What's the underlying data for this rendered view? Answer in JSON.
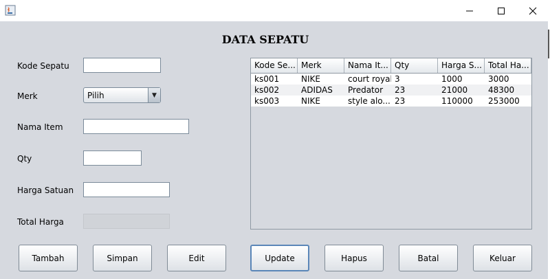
{
  "window": {
    "title": "",
    "minimize_glyph": "—",
    "maximize_glyph": "☐",
    "close_glyph": "✕"
  },
  "form": {
    "title": "DATA SEPATU",
    "fields": {
      "kode_sepatu": {
        "label": "Kode Sepatu",
        "value": ""
      },
      "merk": {
        "label": "Merk",
        "selected": "Pilih"
      },
      "nama_item": {
        "label": "Nama Item",
        "value": ""
      },
      "qty": {
        "label": "Qty",
        "value": ""
      },
      "harga_satuan": {
        "label": "Harga Satuan",
        "value": ""
      },
      "total_harga": {
        "label": "Total Harga",
        "value": ""
      }
    }
  },
  "table": {
    "headers": [
      "Kode Se...",
      "Merk",
      "Nama It...",
      "Qty",
      "Harga S...",
      "Total Ha..."
    ],
    "rows": [
      [
        "ks001",
        "NIKE",
        "court royal",
        "3",
        "1000",
        "3000"
      ],
      [
        "ks002",
        "ADIDAS",
        "Predator",
        "23",
        "21000",
        "48300"
      ],
      [
        "ks003",
        "NIKE",
        "style alo...",
        "23",
        "110000",
        "253000"
      ]
    ]
  },
  "buttons": {
    "tambah": "Tambah",
    "simpan": "Simpan",
    "edit": "Edit",
    "update": "Update",
    "hapus": "Hapus",
    "batal": "Batal",
    "keluar": "Keluar"
  },
  "colors": {
    "panel_bg": "#d6d9df",
    "focus_border": "#5a86b8"
  }
}
